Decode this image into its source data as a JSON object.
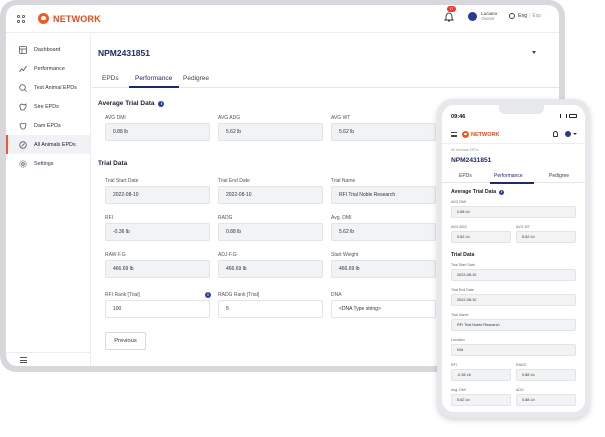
{
  "app": {
    "brand": "NETWORK",
    "notification_count": "17"
  },
  "user": {
    "name": "Luciano",
    "role": "Owner"
  },
  "language": {
    "current": "Eng",
    "other": "Esp"
  },
  "sidebar": {
    "items": [
      {
        "label": "Dashboard",
        "icon": "dashboard-icon"
      },
      {
        "label": "Performance",
        "icon": "performance-icon"
      },
      {
        "label": "Test Animal EPDs",
        "icon": "test-animal-icon"
      },
      {
        "label": "Sire EPDs",
        "icon": "sire-icon"
      },
      {
        "label": "Dam EPDs",
        "icon": "dam-icon"
      },
      {
        "label": "All Animals EPDs",
        "icon": "all-animals-icon"
      },
      {
        "label": "Settings",
        "icon": "settings-icon"
      }
    ]
  },
  "record": {
    "id": "NPM2431851"
  },
  "tabs": [
    {
      "label": "EPDs"
    },
    {
      "label": "Performance"
    },
    {
      "label": "Pedigree"
    }
  ],
  "avg_trial": {
    "title": "Average Trial Data",
    "fields": [
      {
        "label": "AVG DMI",
        "value": "0.88 lb"
      },
      {
        "label": "AVG ADG",
        "value": "5.62 lb"
      },
      {
        "label": "AVG WT",
        "value": "5.62 lb"
      }
    ]
  },
  "trial": {
    "title": "Trial Data",
    "fields": [
      {
        "label": "Trial Start Date",
        "value": "2022-08-10"
      },
      {
        "label": "Trial End Date",
        "value": "2022-08-10"
      },
      {
        "label": "Trial Name",
        "value": "RFI Trial Noble Research"
      },
      {
        "label": "RFI",
        "value": "-0.36 lb"
      },
      {
        "label": "RADG",
        "value": "0.88 lb"
      },
      {
        "label": "Avg. DMI",
        "value": "5.62 lb"
      },
      {
        "label": "RAW F.G",
        "value": "466.69 lb"
      },
      {
        "label": "ADJ F.G",
        "value": "466.69 lb"
      },
      {
        "label": "Start Weight",
        "value": "466.69 lb"
      },
      {
        "label": "RFI Rank [Trial]",
        "value": "100"
      },
      {
        "label": "RADG Rank [Trial]",
        "value": "5"
      },
      {
        "label": "DNA",
        "value": "<DNA Type string>"
      }
    ]
  },
  "buttons": {
    "previous": "Previous"
  },
  "phone": {
    "time": "09:46",
    "breadcrumb": "All Animals EPDs",
    "record_id": "NPM2431851",
    "tabs": [
      {
        "label": "EPDs"
      },
      {
        "label": "Performance"
      },
      {
        "label": "Pedigree"
      }
    ],
    "avg_title": "Average Trial Data",
    "avg_fields": [
      {
        "label": "AVG DMI",
        "value": "0.88 Lb"
      },
      {
        "label": "AVG ADG",
        "value": "5.62 Lb"
      },
      {
        "label": "AVG WT",
        "value": "5.62 Lb"
      }
    ],
    "trial_title": "Trial Data",
    "trial_fields": [
      {
        "label": "Trial Start Date",
        "value": "2022-08-10"
      },
      {
        "label": "Trial End Date",
        "value": "2022-08-10"
      },
      {
        "label": "Trial Name",
        "value": "RFI Trial Noble Research"
      },
      {
        "label": "Location",
        "value": "N/A"
      },
      {
        "label": "RFI",
        "value": "-0.36 Lb"
      },
      {
        "label": "RADG",
        "value": "0.88 Lb"
      },
      {
        "label": "Avg. DMI",
        "value": "5.62 Lb"
      },
      {
        "label": "ADG",
        "value": "0.88 Lb"
      }
    ]
  }
}
